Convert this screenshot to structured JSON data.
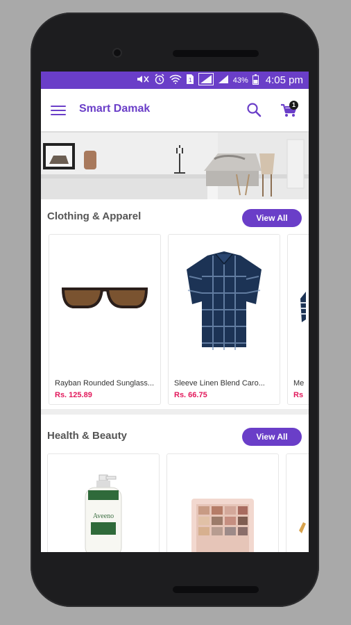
{
  "status_bar": {
    "battery": "43%",
    "time": "4:05 pm",
    "icons": [
      "mute-icon",
      "alarm-icon",
      "wifi-icon",
      "sim-icon",
      "signal-icon",
      "signal-icon",
      "battery-icon"
    ]
  },
  "app_bar": {
    "title": "Smart Damak",
    "cart_count": "1"
  },
  "sections": [
    {
      "title": "Clothing & Apparel",
      "view_all": "View All",
      "products": [
        {
          "name": "Rayban Rounded Sunglass...",
          "price": "Rs. 125.89"
        },
        {
          "name": "Sleeve Linen Blend Caro...",
          "price": "Rs. 66.75"
        },
        {
          "name": "Me",
          "price": "Rs"
        }
      ]
    },
    {
      "title": "Health & Beauty",
      "view_all": "View All",
      "products": [
        {
          "name": "",
          "price": ""
        },
        {
          "name": "",
          "price": ""
        }
      ]
    }
  ],
  "colors": {
    "primary": "#6a3ec8",
    "price": "#e2185b",
    "phone_body": "#1d1d1f"
  }
}
